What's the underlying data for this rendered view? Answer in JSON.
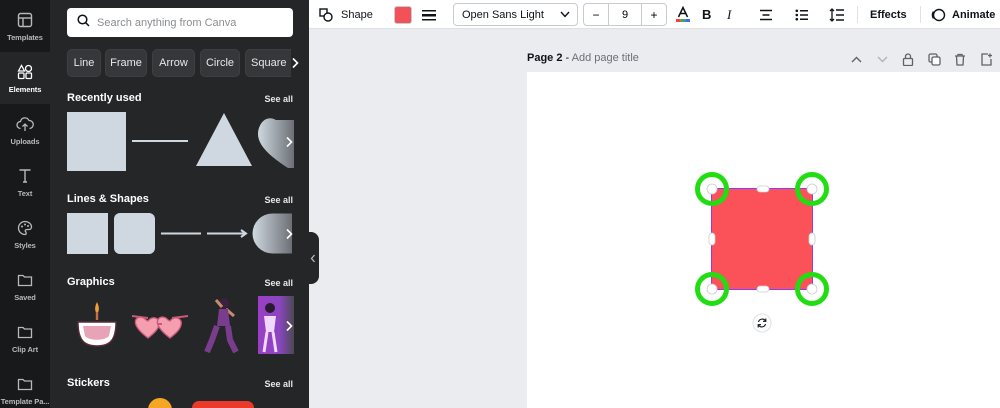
{
  "rail": {
    "items": [
      {
        "label": "Templates"
      },
      {
        "label": "Elements"
      },
      {
        "label": "Uploads"
      },
      {
        "label": "Text"
      },
      {
        "label": "Styles"
      },
      {
        "label": "Saved"
      },
      {
        "label": "Clip Art"
      },
      {
        "label": "Template Pa..."
      }
    ]
  },
  "search": {
    "placeholder": "Search anything from Canva"
  },
  "chips": [
    "Line",
    "Frame",
    "Arrow",
    "Circle",
    "Square"
  ],
  "sections": {
    "recently_used": {
      "title": "Recently used",
      "see_all": "See all"
    },
    "lines_shapes": {
      "title": "Lines & Shapes",
      "see_all": "See all"
    },
    "graphics": {
      "title": "Graphics",
      "see_all": "See all"
    },
    "stickers": {
      "title": "Stickers",
      "see_all": "See all"
    }
  },
  "toolbar": {
    "shape_label": "Shape",
    "fill_color": "#f05258",
    "font_name": "Open Sans Light",
    "font_size": "9",
    "minus": "−",
    "plus": "+",
    "bold": "B",
    "italic": "I",
    "effects": "Effects",
    "animate": "Animate"
  },
  "page": {
    "name": "Page 2",
    "separator": " - ",
    "add_title": "Add page title"
  },
  "colors": {
    "shape_fill": "#fb5158",
    "selection": "#8b3dff",
    "highlight": "#22dd11",
    "shape_swatch": "#cfd8e0"
  }
}
